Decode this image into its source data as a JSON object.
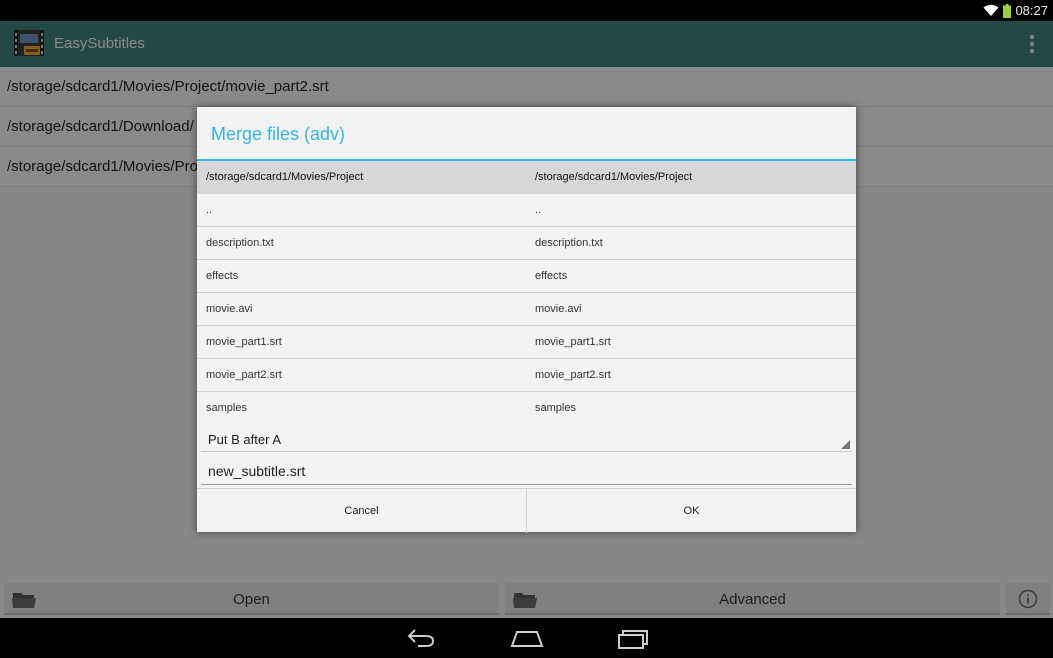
{
  "status": {
    "time": "08:27"
  },
  "app": {
    "title": "EasySubtitles"
  },
  "background_list": [
    "/storage/sdcard1/Movies/Project/movie_part2.srt",
    "/storage/sdcard1/Download/",
    "/storage/sdcard1/Movies/Pro"
  ],
  "bottom_bar": {
    "open_label": "Open",
    "advanced_label": "Advanced"
  },
  "dialog": {
    "title": "Merge files (adv)",
    "header": {
      "a": "/storage/sdcard1/Movies/Project",
      "b": "/storage/sdcard1/Movies/Project"
    },
    "files": [
      {
        "a": "..",
        "b": ".."
      },
      {
        "a": "description.txt",
        "b": "description.txt"
      },
      {
        "a": "effects",
        "b": "effects"
      },
      {
        "a": "movie.avi",
        "b": "movie.avi"
      },
      {
        "a": "movie_part1.srt",
        "b": "movie_part1.srt"
      },
      {
        "a": "movie_part2.srt",
        "b": "movie_part2.srt"
      },
      {
        "a": "samples",
        "b": "samples"
      }
    ],
    "mode": "Put B after A",
    "filename": "new_subtitle.srt",
    "cancel_label": "Cancel",
    "ok_label": "OK"
  },
  "colors": {
    "action_bar": "#3f7f78",
    "accent": "#33b5e5"
  },
  "icons": {
    "status": [
      "wifi-icon",
      "battery-icon"
    ],
    "action": "overflow-menu-icon",
    "bottom": [
      "folder-icon",
      "info-icon"
    ],
    "nav": [
      "back-icon",
      "home-icon",
      "recents-icon"
    ]
  }
}
